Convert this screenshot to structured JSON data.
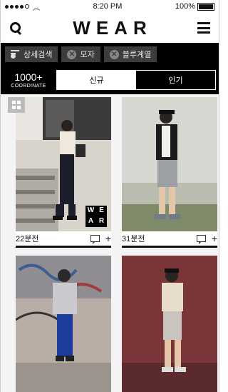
{
  "status": {
    "time": "8:20 PM",
    "battery": "100%"
  },
  "header": {
    "logo": "WEAR",
    "icons": [
      "search-icon",
      "menu-icon"
    ]
  },
  "filters": [
    {
      "label": "상세검색",
      "icon": "filter-search-icon"
    },
    {
      "label": "모자",
      "icon": "remove-icon"
    },
    {
      "label": "블루계열",
      "icon": "remove-icon"
    }
  ],
  "counter": {
    "value": "1000+",
    "label": "COORDINATE"
  },
  "tabs": [
    {
      "label": "신규",
      "active": true
    },
    {
      "label": "인기",
      "active": false
    }
  ],
  "cards": [
    {
      "time": "22분전"
    },
    {
      "time": "31분전"
    }
  ],
  "badge": {
    "letters": [
      "W",
      "E",
      "A",
      "R"
    ]
  },
  "colors": {
    "bar": "#000000",
    "chip": "#3c3c3c",
    "accent": "#111111"
  }
}
